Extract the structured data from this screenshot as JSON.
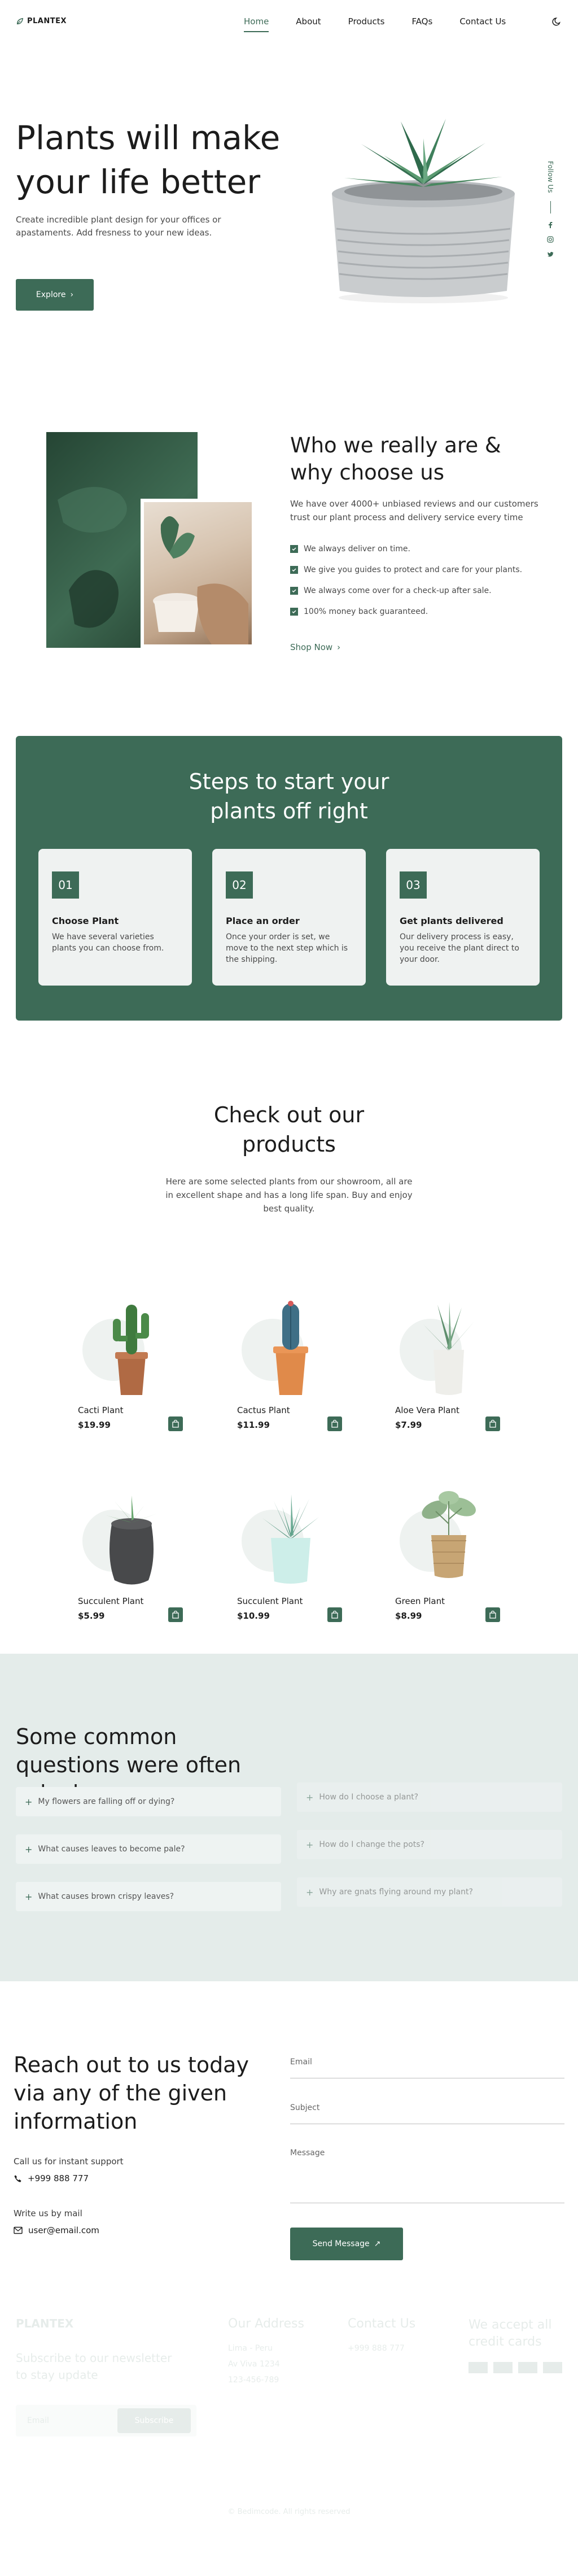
{
  "brand": {
    "name": "PLANTEX",
    "accent": "#3d6b57",
    "bg_light": "#eff2f1"
  },
  "nav": {
    "items": [
      "Home",
      "About",
      "Products",
      "FAQs",
      "Contact Us"
    ],
    "active": "Home"
  },
  "theme_toggle_icon": "moon-icon",
  "hero": {
    "title": "Plants will make your life better",
    "description": "Create incredible plant design for your offices or apastaments. Add fresness to your new ideas.",
    "button": "Explore",
    "follow_label": "Follow Us",
    "social_icons": [
      "facebook-icon",
      "instagram-icon",
      "twitter-icon"
    ]
  },
  "about": {
    "title": "Who we really are & why choose us",
    "description": "We have over 4000+ unbiased reviews and our customers trust our plant process and delivery service every time",
    "checklist": [
      "We always deliver on time.",
      "We give you guides to protect and care for your plants.",
      "We always come over for a check-up after sale.",
      "100% money back guaranteed."
    ],
    "link": "Shop Now"
  },
  "steps": {
    "title": "Steps to start your plants off right",
    "items": [
      {
        "num": "01",
        "name": "Choose Plant",
        "desc": "We have several varieties plants you can choose from."
      },
      {
        "num": "02",
        "name": "Place an order",
        "desc": "Once your order is set, we move to the next step which is the shipping."
      },
      {
        "num": "03",
        "name": "Get plants delivered",
        "desc": "Our delivery process is easy, you receive the plant direct to your door."
      }
    ]
  },
  "products": {
    "title": "Check out our products",
    "description": "Here are some selected plants from our showroom, all are in excellent shape and has a long life span. Buy and enjoy best quality.",
    "items": [
      {
        "name": "Cacti Plant",
        "price": "$19.99"
      },
      {
        "name": "Cactus Plant",
        "price": "$11.99"
      },
      {
        "name": "Aloe Vera Plant",
        "price": "$7.99"
      },
      {
        "name": "Succulent Plant",
        "price": "$5.99"
      },
      {
        "name": "Succulent Plant",
        "price": "$10.99"
      },
      {
        "name": "Green Plant",
        "price": "$8.99"
      }
    ]
  },
  "faq": {
    "title": "Some common questions were often asked",
    "left": [
      "My flowers are falling off or dying?",
      "What causes leaves to become pale?",
      "What causes brown crispy leaves?"
    ],
    "right": [
      "How do I choose a plant?",
      "How do I change the pots?",
      "Why are gnats flying around my plant?"
    ]
  },
  "contact": {
    "title": "Reach out to us today via any of the given information",
    "call_label": "Call us for instant support",
    "phone": "+999 888 777",
    "write_label": "Write us by mail",
    "email": "user@email.com",
    "form": {
      "email": "Email",
      "subject": "Subject",
      "message": "Message",
      "button": "Send Message"
    }
  },
  "footer": {
    "newsletter": "Subscribe to our newsletter to stay update",
    "newsletter_placeholder": "Email",
    "newsletter_button": "Subscribe",
    "address_title": "Our Address",
    "address_lines": [
      "Lima - Peru",
      "Av Viva 1234",
      "123-456-789"
    ],
    "contact_title": "Contact Us",
    "contact_lines": [
      "+999 888 777"
    ],
    "payment_title": "We accept all credit cards",
    "payment_icons": [
      "visa-icon",
      "mastercard-icon",
      "paypal-icon",
      "amex-icon"
    ],
    "copyright": "© Bedimcode. All rights reserved"
  }
}
